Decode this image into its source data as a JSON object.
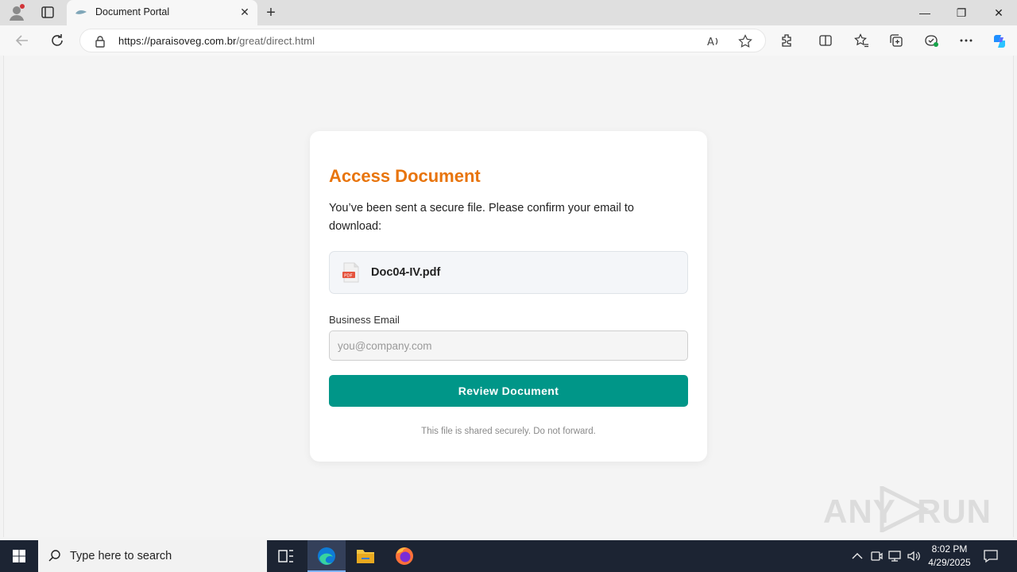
{
  "browser": {
    "tab_title": "Document Portal",
    "url_host": "https://paraisoveg.com.br",
    "url_path": "/great/direct.html"
  },
  "card": {
    "title": "Access Document",
    "description": "You’ve been sent a secure file. Please confirm your email to download:",
    "file_name": "Doc04-IV.pdf",
    "email_label": "Business Email",
    "email_placeholder": "you@company.com",
    "email_value": "",
    "button_label": "Review Document",
    "footnote": "This file is shared securely. Do not forward."
  },
  "watermark": {
    "left": "ANY",
    "right": "RUN"
  },
  "taskbar": {
    "search_placeholder": "Type here to search",
    "time": "8:02 PM",
    "date": "4/29/2025"
  },
  "colors": {
    "title_accent": "#e8740c",
    "button_bg": "#009688"
  }
}
